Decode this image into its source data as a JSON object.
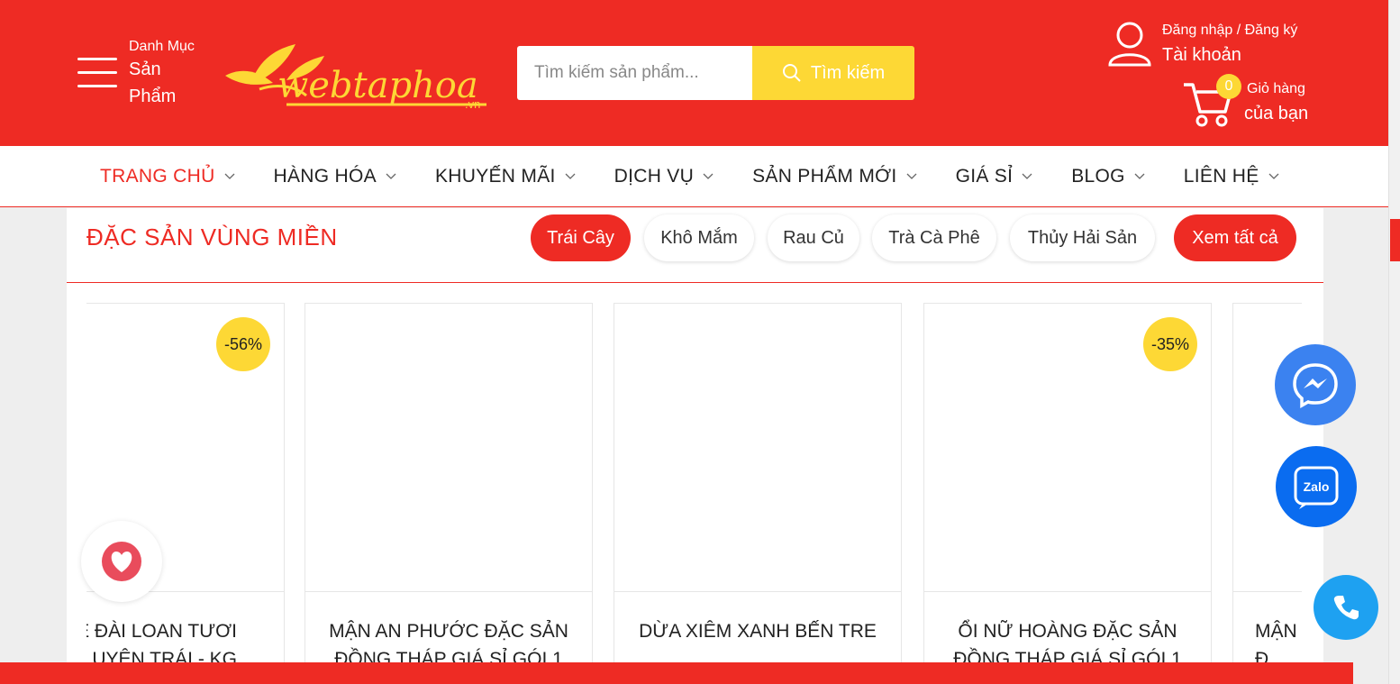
{
  "header": {
    "menu_small": "Danh Mục",
    "menu_big": "Sản Phẩm",
    "logo_text": "webtaphoa",
    "logo_suffix": ".vn",
    "search_placeholder": "Tìm kiếm sản phẩm...",
    "search_button": "Tìm kiếm",
    "account_line1": "Đăng nhập / Đăng ký",
    "account_line2": "Tài khoản",
    "cart_count": "0",
    "cart_line1": "Giỏ hàng",
    "cart_line2": "của bạn"
  },
  "nav": {
    "items": [
      {
        "label": "TRANG CHỦ"
      },
      {
        "label": "HÀNG HÓA"
      },
      {
        "label": "KHUYẾN MÃI"
      },
      {
        "label": "DỊCH VỤ"
      },
      {
        "label": "SẢN PHẨM MỚI"
      },
      {
        "label": "GIÁ SỈ"
      },
      {
        "label": "BLOG"
      },
      {
        "label": "LIÊN HỆ"
      }
    ]
  },
  "section": {
    "title": "ĐẶC SẢN VÙNG MIỀN",
    "tabs": [
      {
        "label": "Trái Cây"
      },
      {
        "label": "Khô Mắm"
      },
      {
        "label": "Rau Củ"
      },
      {
        "label": "Trà Cà Phê"
      },
      {
        "label": "Thủy Hải Sản"
      }
    ],
    "view_all": "Xem tất cả"
  },
  "products": [
    {
      "name": "Ê ĐÀI LOAN TƯƠI\nUYÊN TRÁI - KG",
      "discount": "-56%"
    },
    {
      "name": "MẬN AN PHƯỚC ĐẶC SẢN\nĐỒNG THÁP GIÁ SỈ GÓI 1",
      "discount": ""
    },
    {
      "name": "DỪA XIÊM XANH BẾN TRE",
      "discount": ""
    },
    {
      "name": "ỔI NỮ HOÀNG ĐẶC SẢN\nĐỒNG THÁP GIÁ SỈ GÓI 1",
      "discount": "-35%"
    },
    {
      "name": "MẬN\nĐ",
      "discount": ""
    }
  ],
  "floating": {
    "zalo_label": "Zalo"
  },
  "colors": {
    "brand_red": "#ee2b24",
    "accent_yellow": "#fdd835",
    "messenger_blue": "#3b82f0",
    "zalo_blue": "#0a6cf0",
    "phone_blue": "#1ea1f1"
  }
}
